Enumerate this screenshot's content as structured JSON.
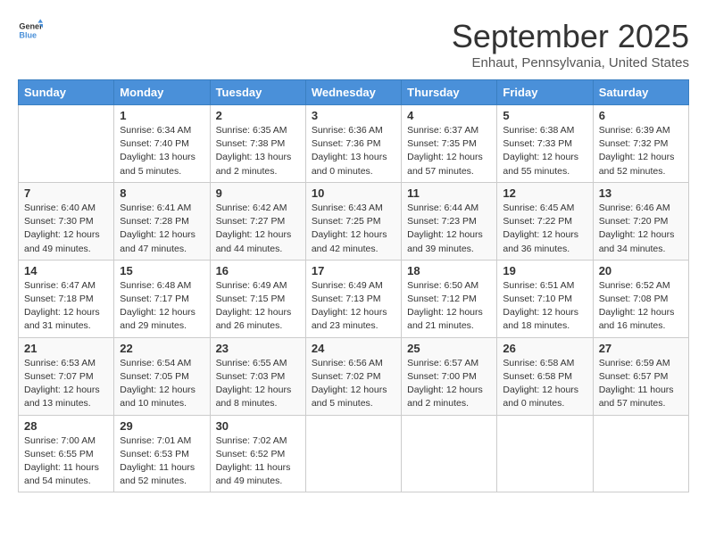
{
  "logo": {
    "general": "General",
    "blue": "Blue"
  },
  "title": "September 2025",
  "subtitle": "Enhaut, Pennsylvania, United States",
  "days_of_week": [
    "Sunday",
    "Monday",
    "Tuesday",
    "Wednesday",
    "Thursday",
    "Friday",
    "Saturday"
  ],
  "weeks": [
    [
      {
        "day": "",
        "info": ""
      },
      {
        "day": "1",
        "info": "Sunrise: 6:34 AM\nSunset: 7:40 PM\nDaylight: 13 hours\nand 5 minutes."
      },
      {
        "day": "2",
        "info": "Sunrise: 6:35 AM\nSunset: 7:38 PM\nDaylight: 13 hours\nand 2 minutes."
      },
      {
        "day": "3",
        "info": "Sunrise: 6:36 AM\nSunset: 7:36 PM\nDaylight: 13 hours\nand 0 minutes."
      },
      {
        "day": "4",
        "info": "Sunrise: 6:37 AM\nSunset: 7:35 PM\nDaylight: 12 hours\nand 57 minutes."
      },
      {
        "day": "5",
        "info": "Sunrise: 6:38 AM\nSunset: 7:33 PM\nDaylight: 12 hours\nand 55 minutes."
      },
      {
        "day": "6",
        "info": "Sunrise: 6:39 AM\nSunset: 7:32 PM\nDaylight: 12 hours\nand 52 minutes."
      }
    ],
    [
      {
        "day": "7",
        "info": "Sunrise: 6:40 AM\nSunset: 7:30 PM\nDaylight: 12 hours\nand 49 minutes."
      },
      {
        "day": "8",
        "info": "Sunrise: 6:41 AM\nSunset: 7:28 PM\nDaylight: 12 hours\nand 47 minutes."
      },
      {
        "day": "9",
        "info": "Sunrise: 6:42 AM\nSunset: 7:27 PM\nDaylight: 12 hours\nand 44 minutes."
      },
      {
        "day": "10",
        "info": "Sunrise: 6:43 AM\nSunset: 7:25 PM\nDaylight: 12 hours\nand 42 minutes."
      },
      {
        "day": "11",
        "info": "Sunrise: 6:44 AM\nSunset: 7:23 PM\nDaylight: 12 hours\nand 39 minutes."
      },
      {
        "day": "12",
        "info": "Sunrise: 6:45 AM\nSunset: 7:22 PM\nDaylight: 12 hours\nand 36 minutes."
      },
      {
        "day": "13",
        "info": "Sunrise: 6:46 AM\nSunset: 7:20 PM\nDaylight: 12 hours\nand 34 minutes."
      }
    ],
    [
      {
        "day": "14",
        "info": "Sunrise: 6:47 AM\nSunset: 7:18 PM\nDaylight: 12 hours\nand 31 minutes."
      },
      {
        "day": "15",
        "info": "Sunrise: 6:48 AM\nSunset: 7:17 PM\nDaylight: 12 hours\nand 29 minutes."
      },
      {
        "day": "16",
        "info": "Sunrise: 6:49 AM\nSunset: 7:15 PM\nDaylight: 12 hours\nand 26 minutes."
      },
      {
        "day": "17",
        "info": "Sunrise: 6:49 AM\nSunset: 7:13 PM\nDaylight: 12 hours\nand 23 minutes."
      },
      {
        "day": "18",
        "info": "Sunrise: 6:50 AM\nSunset: 7:12 PM\nDaylight: 12 hours\nand 21 minutes."
      },
      {
        "day": "19",
        "info": "Sunrise: 6:51 AM\nSunset: 7:10 PM\nDaylight: 12 hours\nand 18 minutes."
      },
      {
        "day": "20",
        "info": "Sunrise: 6:52 AM\nSunset: 7:08 PM\nDaylight: 12 hours\nand 16 minutes."
      }
    ],
    [
      {
        "day": "21",
        "info": "Sunrise: 6:53 AM\nSunset: 7:07 PM\nDaylight: 12 hours\nand 13 minutes."
      },
      {
        "day": "22",
        "info": "Sunrise: 6:54 AM\nSunset: 7:05 PM\nDaylight: 12 hours\nand 10 minutes."
      },
      {
        "day": "23",
        "info": "Sunrise: 6:55 AM\nSunset: 7:03 PM\nDaylight: 12 hours\nand 8 minutes."
      },
      {
        "day": "24",
        "info": "Sunrise: 6:56 AM\nSunset: 7:02 PM\nDaylight: 12 hours\nand 5 minutes."
      },
      {
        "day": "25",
        "info": "Sunrise: 6:57 AM\nSunset: 7:00 PM\nDaylight: 12 hours\nand 2 minutes."
      },
      {
        "day": "26",
        "info": "Sunrise: 6:58 AM\nSunset: 6:58 PM\nDaylight: 12 hours\nand 0 minutes."
      },
      {
        "day": "27",
        "info": "Sunrise: 6:59 AM\nSunset: 6:57 PM\nDaylight: 11 hours\nand 57 minutes."
      }
    ],
    [
      {
        "day": "28",
        "info": "Sunrise: 7:00 AM\nSunset: 6:55 PM\nDaylight: 11 hours\nand 54 minutes."
      },
      {
        "day": "29",
        "info": "Sunrise: 7:01 AM\nSunset: 6:53 PM\nDaylight: 11 hours\nand 52 minutes."
      },
      {
        "day": "30",
        "info": "Sunrise: 7:02 AM\nSunset: 6:52 PM\nDaylight: 11 hours\nand 49 minutes."
      },
      {
        "day": "",
        "info": ""
      },
      {
        "day": "",
        "info": ""
      },
      {
        "day": "",
        "info": ""
      },
      {
        "day": "",
        "info": ""
      }
    ]
  ]
}
